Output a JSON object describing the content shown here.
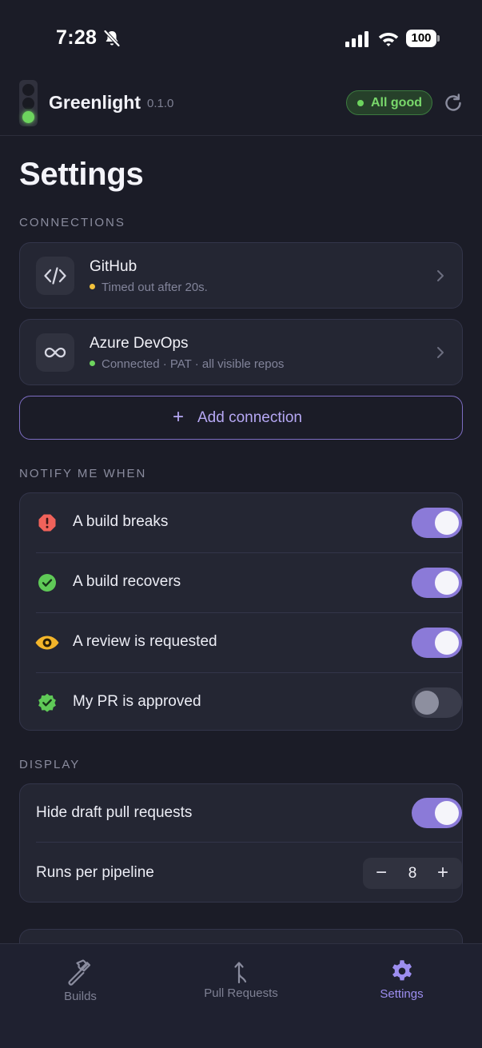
{
  "status_bar": {
    "time": "7:28",
    "battery": "100"
  },
  "header": {
    "app_name": "Greenlight",
    "version": "0.1.0",
    "status": "All good"
  },
  "page_title": "Settings",
  "sections": {
    "connections": "CONNECTIONS",
    "notify": "NOTIFY ME WHEN",
    "display": "DISPLAY"
  },
  "connections": [
    {
      "name": "GitHub",
      "status": "Timed out after 20s.",
      "status_color": "#f3c23c",
      "icon": "code-icon"
    },
    {
      "name": "Azure DevOps",
      "status": "Connected · PAT · all visible repos",
      "status_color": "#6dd45e",
      "icon": "infinity-icon"
    }
  ],
  "add_connection": "Add connection",
  "notify": [
    {
      "label": "A build breaks",
      "icon": "error-octagon-icon",
      "on": true
    },
    {
      "label": "A build recovers",
      "icon": "check-circle-icon",
      "on": true
    },
    {
      "label": "A review is requested",
      "icon": "eye-icon",
      "on": true
    },
    {
      "label": "My PR is approved",
      "icon": "verified-badge-icon",
      "on": false
    }
  ],
  "display": {
    "hide_drafts_label": "Hide draft pull requests",
    "hide_drafts_on": true,
    "runs_label": "Runs per pipeline",
    "runs_value": "8"
  },
  "tabs": [
    {
      "label": "Builds",
      "icon": "hammer-icon",
      "active": false
    },
    {
      "label": "Pull Requests",
      "icon": "merge-icon",
      "active": false
    },
    {
      "label": "Settings",
      "icon": "gear-icon",
      "active": true
    }
  ],
  "colors": {
    "accent": "#8b7ad8",
    "success": "#6dd45e",
    "warning": "#f3c23c",
    "danger": "#f0625a"
  }
}
